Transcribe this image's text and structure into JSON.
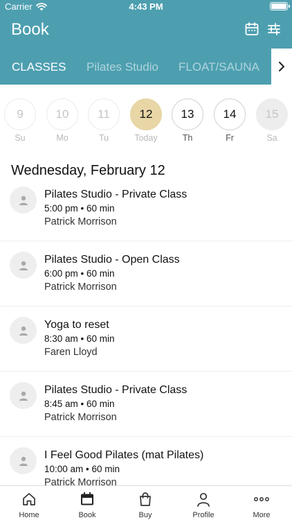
{
  "status_bar": {
    "carrier": "Carrier",
    "time": "4:43 PM"
  },
  "header": {
    "title": "Book"
  },
  "tabs": [
    {
      "label": "CLASSES",
      "active": true
    },
    {
      "label": "Pilates Studio",
      "active": false
    },
    {
      "label": "FLOAT/SAUNA",
      "active": false
    }
  ],
  "days": [
    {
      "num": "9",
      "label": "Su",
      "state": "past"
    },
    {
      "num": "10",
      "label": "Mo",
      "state": "past"
    },
    {
      "num": "11",
      "label": "Tu",
      "state": "past"
    },
    {
      "num": "12",
      "label": "Today",
      "state": "selected"
    },
    {
      "num": "13",
      "label": "Th",
      "state": "active"
    },
    {
      "num": "14",
      "label": "Fr",
      "state": "active"
    },
    {
      "num": "15",
      "label": "Sa",
      "state": "unavailable"
    }
  ],
  "date_heading": "Wednesday, February 12",
  "classes": [
    {
      "name": "Pilates Studio - Private Class",
      "time": "5:00 pm • 60 min",
      "instructor": "Patrick Morrison"
    },
    {
      "name": "Pilates Studio - Open Class",
      "time": "6:00 pm • 60 min",
      "instructor": "Patrick Morrison"
    },
    {
      "name": "Yoga to reset",
      "time": "8:30 am • 60 min",
      "instructor": "Faren Lloyd"
    },
    {
      "name": "Pilates Studio - Private Class",
      "time": "8:45 am • 60 min",
      "instructor": "Patrick Morrison"
    },
    {
      "name": "I Feel Good Pilates (mat Pilates)",
      "time": "10:00 am • 60 min",
      "instructor": "Patrick Morrison"
    }
  ],
  "tabbar": {
    "items": [
      {
        "label": "Home",
        "icon": "home-icon"
      },
      {
        "label": "Book",
        "icon": "calendar-icon",
        "active": true
      },
      {
        "label": "Buy",
        "icon": "shopping-bag-icon"
      },
      {
        "label": "Profile",
        "icon": "person-icon"
      },
      {
        "label": "More",
        "icon": "more-dots-icon"
      }
    ]
  },
  "colors": {
    "header_bg": "#4d9fb0",
    "selected_day": "#e8d6a6",
    "white": "#ffffff"
  }
}
